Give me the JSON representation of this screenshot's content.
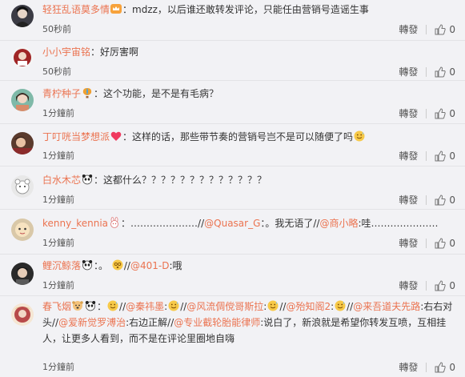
{
  "comments": [
    {
      "username": "轻狂乱语莫多情",
      "prefix": "：",
      "text": "mdzz，以后谁还敢转发评论，只能任由营销号造谣生事",
      "time": "50秒前",
      "repost": "轉發",
      "likes": "0",
      "avatar_color": "#3b3b44",
      "badge_icon": "vip-crown-icon"
    },
    {
      "username": "小小宇宙铭",
      "prefix": "：",
      "text": "好厉害啊",
      "time": "50秒前",
      "repost": "轉發",
      "likes": "0",
      "avatar_color": "#a02626"
    },
    {
      "username": "青柠种子",
      "prefix": "：",
      "text": "这个功能，是不是有毛病？",
      "time": "1分鐘前",
      "repost": "轉發",
      "likes": "0",
      "avatar_color": "#7fb9a8",
      "badge_icon": "hot-air-balloon-icon"
    },
    {
      "username": "丁叮咣当梦想派",
      "prefix": "：",
      "text": "这样的话，那些带节奏的营销号岂不是可以随便了吗",
      "time": "1分鐘前",
      "repost": "轉發",
      "likes": "0",
      "avatar_color": "#5a3a2c",
      "badge_icon": "heart-icon"
    },
    {
      "username": "白水木芯",
      "prefix": "：",
      "text": "这都什么？？？？？？？？？？？？？",
      "time": "1分鐘前",
      "repost": "轉發",
      "likes": "0",
      "avatar_color": "#e8e8e8",
      "badge_icon": "panda-icon"
    },
    {
      "username": "kenny_kennia",
      "prefix": "：",
      "seg1": "…………………//",
      "mention1": "@Quasar_G",
      "seg2": "：。我无语了//",
      "mention2": "@商小略",
      "seg3": ":哇…………………",
      "time": "1分鐘前",
      "repost": "轉發",
      "likes": "0",
      "avatar_color": "#d9c8a8",
      "badge_icon": "rabbit-icon"
    },
    {
      "username": "鲤沉鲸落",
      "prefix": "：。",
      "seg1": "//",
      "mention1": "@401-D",
      "seg2": ":哦",
      "time": "1分鐘前",
      "repost": "轉發",
      "likes": "0",
      "avatar_color": "#2a2a2a",
      "badge_icon": "panda-icon"
    },
    {
      "username": "春飞烟",
      "prefix": "：",
      "seg1": "//",
      "mention1": "@秦祎墨",
      "seg2": ":",
      "seg3": "//",
      "mention2": "@风流倜傥哥斯拉",
      "seg4": ":",
      "seg5": "//",
      "mention3": "@殆知阁2",
      "seg6": ":",
      "seg7": "//",
      "mention4": "@来吾道夫先路",
      "seg8": ":右右对头//",
      "mention5": "@爱新觉罗溥治",
      "seg9": ":右边正解//",
      "mention6": "@专业截轮胎能律师",
      "seg10": ":说白了，新浪就是希望你转发互喷，互相挂人，让更多人看到，而不是在评论里圈地自嗨",
      "time": "1分鐘前",
      "repost": "轉發",
      "likes": "0",
      "avatar_color": "#b84a4a",
      "badge_icon": "doge-emoji-icon"
    }
  ]
}
